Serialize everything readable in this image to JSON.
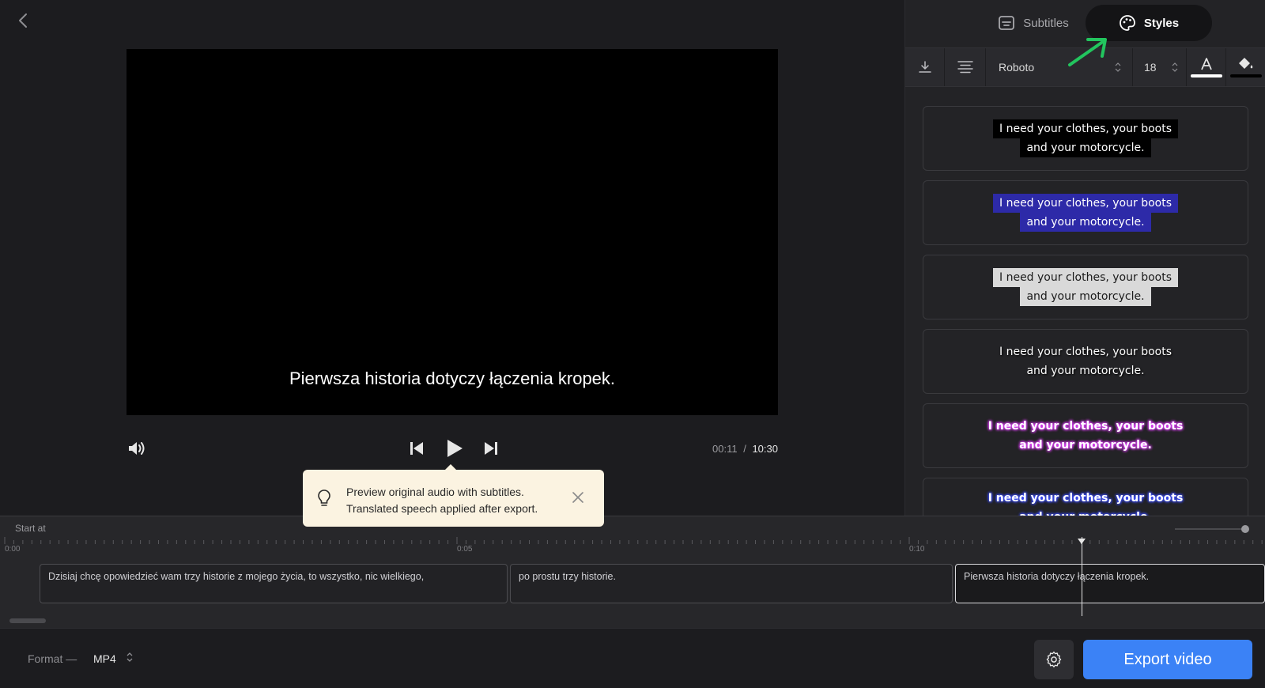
{
  "video": {
    "subtitle": "Pierwsza historia dotyczy łączenia kropek."
  },
  "player": {
    "current_time": "00:11",
    "separator": "/",
    "total_time": "10:30"
  },
  "tooltip": {
    "line1": "Preview original audio with subtitles.",
    "line2": "Translated speech applied after export."
  },
  "tabs": {
    "subtitles": "Subtitles",
    "styles": "Styles",
    "active": "Styles"
  },
  "toolbar": {
    "font": "Roboto",
    "size": "18",
    "text_color": "#ffffff",
    "fill_color": "#000000"
  },
  "presets": [
    {
      "line1": "I need your clothes, your boots",
      "line2": "and your motorcycle.",
      "style": "black-box",
      "text_color": "#ffffff",
      "bg_color": "#000000"
    },
    {
      "line1": "I need your clothes, your boots",
      "line2": "and your motorcycle.",
      "style": "blue-box",
      "text_color": "#ffffff",
      "bg_color": "#2d2aa8"
    },
    {
      "line1": "I need your clothes, your boots",
      "line2": "and your motorcycle.",
      "style": "light-box",
      "text_color": "#1a1a1a",
      "bg_color": "#d9d9d9"
    },
    {
      "line1": "I need your clothes, your boots",
      "line2": "and your motorcycle.",
      "style": "plain-shadow",
      "text_color": "#ffffff",
      "bg_color": ""
    },
    {
      "line1": "I need your clothes, your boots",
      "line2": "and your motorcycle.",
      "style": "magenta-glow",
      "text_color": "#ffffff",
      "bg_color": "#e040fb"
    },
    {
      "line1": "I need your clothes, your boots",
      "line2": "and your motorcycle.",
      "style": "blue-glow",
      "text_color": "#ffffff",
      "bg_color": "#3b4dff"
    }
  ],
  "timeline": {
    "start_label": "Start at",
    "ticks": [
      "0:00",
      "0:05",
      "0:10"
    ],
    "clips": [
      {
        "text": "Dzisiaj chcę opowiedzieć wam trzy historie z mojego życia, to wszystko, nic wielkiego,",
        "active": false
      },
      {
        "text": "po prostu trzy historie.",
        "active": false
      },
      {
        "text": "Pierwsza historia dotyczy łączenia kropek.",
        "active": true
      }
    ]
  },
  "bottom": {
    "format_label": "Format —",
    "format_value": "MP4",
    "export_label": "Export video"
  },
  "colors": {
    "accent": "#3b82f6",
    "annotation_arrow": "#22c55e"
  }
}
